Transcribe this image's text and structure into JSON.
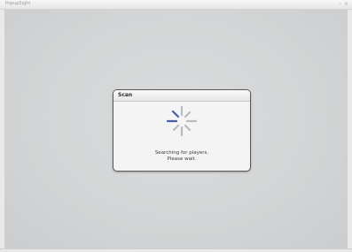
{
  "window": {
    "app_title": "PopupSight",
    "minimize_glyph": "–",
    "close_glyph": "×"
  },
  "dialog": {
    "title": "Scan",
    "message_line1": "Searching for players.",
    "message_line2": "Please wait.",
    "spinner_icon": "loading-spinner-icon",
    "colors": {
      "spinner_active": "#4a5da8",
      "spinner_inactive": "#b9bcbf"
    }
  }
}
